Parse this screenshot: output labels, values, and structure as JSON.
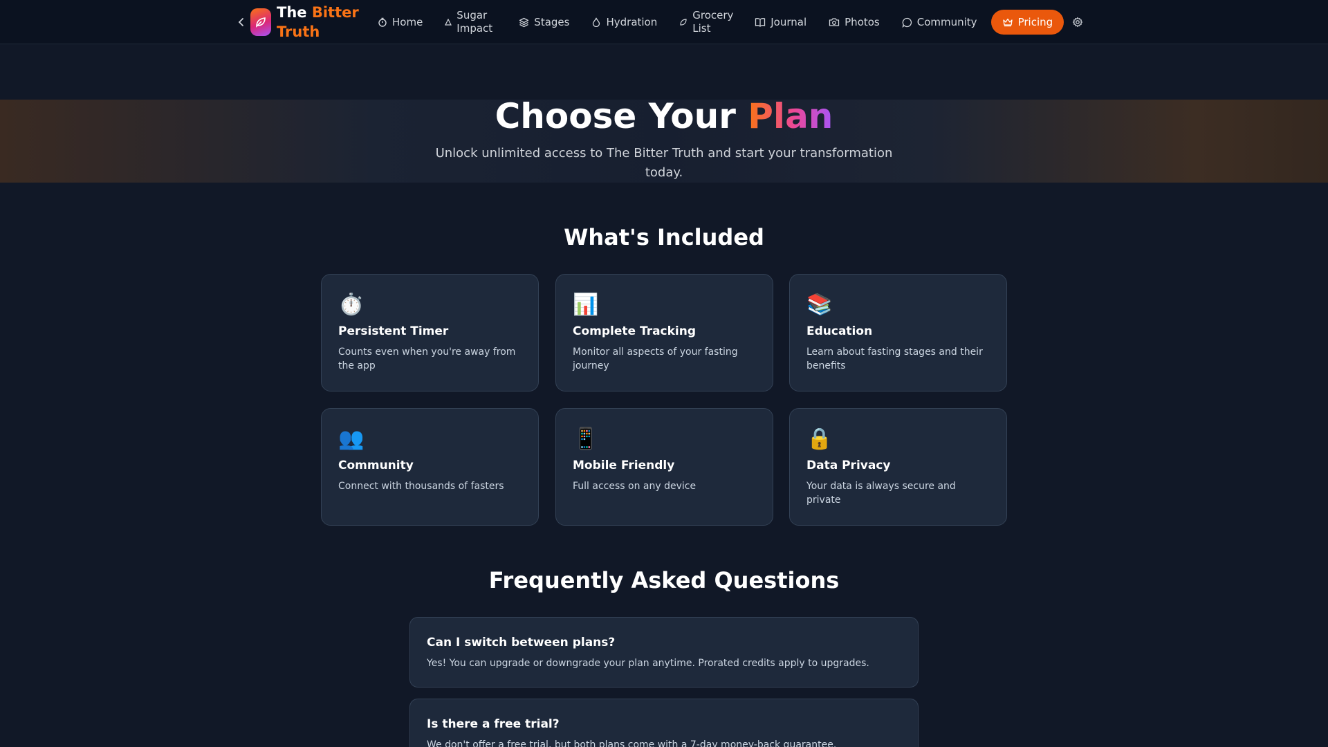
{
  "nav": {
    "brand_word1": "The",
    "brand_word2": "Bitter Truth",
    "links": [
      {
        "label": "Home",
        "icon": "timer-icon"
      },
      {
        "label": "Sugar Impact",
        "icon": "triangle-icon"
      },
      {
        "label": "Stages",
        "icon": "layers-icon"
      },
      {
        "label": "Hydration",
        "icon": "droplet-icon"
      },
      {
        "label": "Grocery List",
        "icon": "leaf-icon"
      },
      {
        "label": "Journal",
        "icon": "book-icon"
      },
      {
        "label": "Photos",
        "icon": "camera-icon"
      },
      {
        "label": "Community",
        "icon": "chat-icon"
      }
    ],
    "pricing_label": "Pricing",
    "accent_color": "#ea580c"
  },
  "hero": {
    "title_main": "Choose Your ",
    "title_accent": "Plan",
    "subtitle": "Unlock unlimited access to The Bitter Truth and start your transformation today."
  },
  "included": {
    "title": "What's Included",
    "items": [
      {
        "icon": "⏱️",
        "icon_name": "stopwatch-icon",
        "title": "Persistent Timer",
        "desc": "Counts even when you're away from the app"
      },
      {
        "icon": "📊",
        "icon_name": "bar-chart-icon",
        "title": "Complete Tracking",
        "desc": "Monitor all aspects of your fasting journey"
      },
      {
        "icon": "📚",
        "icon_name": "books-icon",
        "title": "Education",
        "desc": "Learn about fasting stages and their benefits"
      },
      {
        "icon": "👥",
        "icon_name": "people-icon",
        "title": "Community",
        "desc": "Connect with thousands of fasters"
      },
      {
        "icon": "📱",
        "icon_name": "phone-icon",
        "title": "Mobile Friendly",
        "desc": "Full access on any device"
      },
      {
        "icon": "🔒",
        "icon_name": "lock-icon",
        "title": "Data Privacy",
        "desc": "Your data is always secure and private"
      }
    ]
  },
  "faq": {
    "title": "Frequently Asked Questions",
    "items": [
      {
        "q": "Can I switch between plans?",
        "a": "Yes! You can upgrade or downgrade your plan anytime. Prorated credits apply to upgrades."
      },
      {
        "q": "Is there a free trial?",
        "a": "We don't offer a free trial, but both plans come with a 7-day money-back guarantee."
      }
    ]
  }
}
